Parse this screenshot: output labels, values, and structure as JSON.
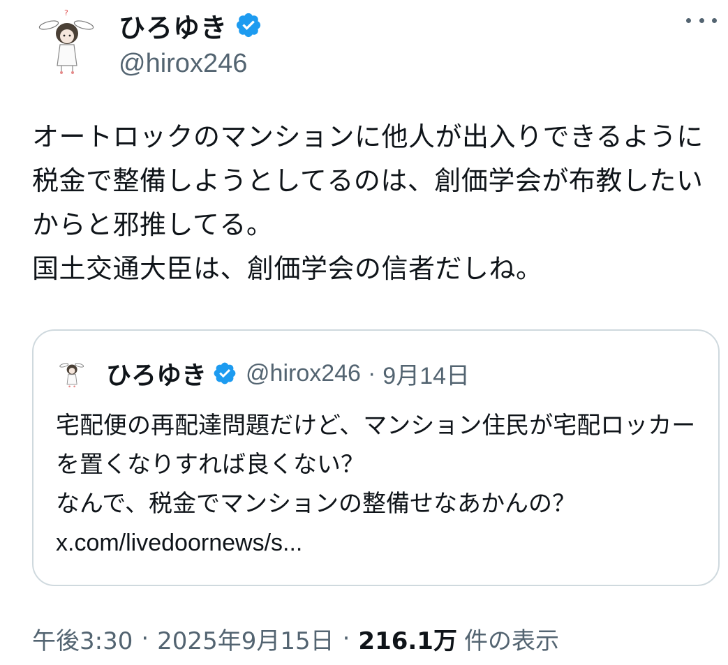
{
  "author": {
    "display_name": "ひろゆき",
    "handle": "@hirox246",
    "verified_icon": "verified-badge-icon",
    "verified_color": "#1d9bf0"
  },
  "more_icon": "more-options-icon",
  "tweet": {
    "text": "オートロックのマンションに他人が出入りできるように税金で整備しようとしてるのは、創価学会が布教したいからと邪推してる。\n国土交通大臣は、創価学会の信者だしね。"
  },
  "quote": {
    "display_name": "ひろゆき",
    "handle": "@hirox246",
    "separator": "·",
    "date": "9月14日",
    "text": "宅配便の再配達問題だけど、マンション住民が宅配ロッカーを置くなりすれば良くない？\nなんで、税金でマンションの整備せなあかんの？",
    "link": "x.com/livedoornews/s..."
  },
  "meta": {
    "time": "午後3:30",
    "separator": "·",
    "date": "2025年9月15日",
    "views_count": "216.1万",
    "views_label": "件の表示"
  }
}
